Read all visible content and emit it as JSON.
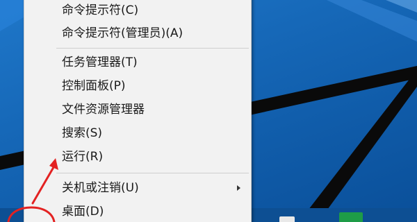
{
  "context_menu": {
    "items": [
      {
        "label": "命令提示符(C)"
      },
      {
        "label": "命令提示符(管理员)(A)"
      },
      {
        "label": "任务管理器(T)"
      },
      {
        "label": "控制面板(P)"
      },
      {
        "label": "文件资源管理器"
      },
      {
        "label": "搜索(S)"
      },
      {
        "label": "运行(R)"
      },
      {
        "label": "关机或注销(U)"
      },
      {
        "label": "桌面(D)"
      }
    ]
  },
  "colors": {
    "desktop_blue": "#1668b8",
    "menu_background": "#f2f2f2",
    "annotation_red": "#e32222",
    "taskbar_tile_green": "#1e9c47"
  },
  "annotation": {
    "arrow_icon": "red-arrow-icon",
    "circle_icon": "red-circle-icon"
  }
}
